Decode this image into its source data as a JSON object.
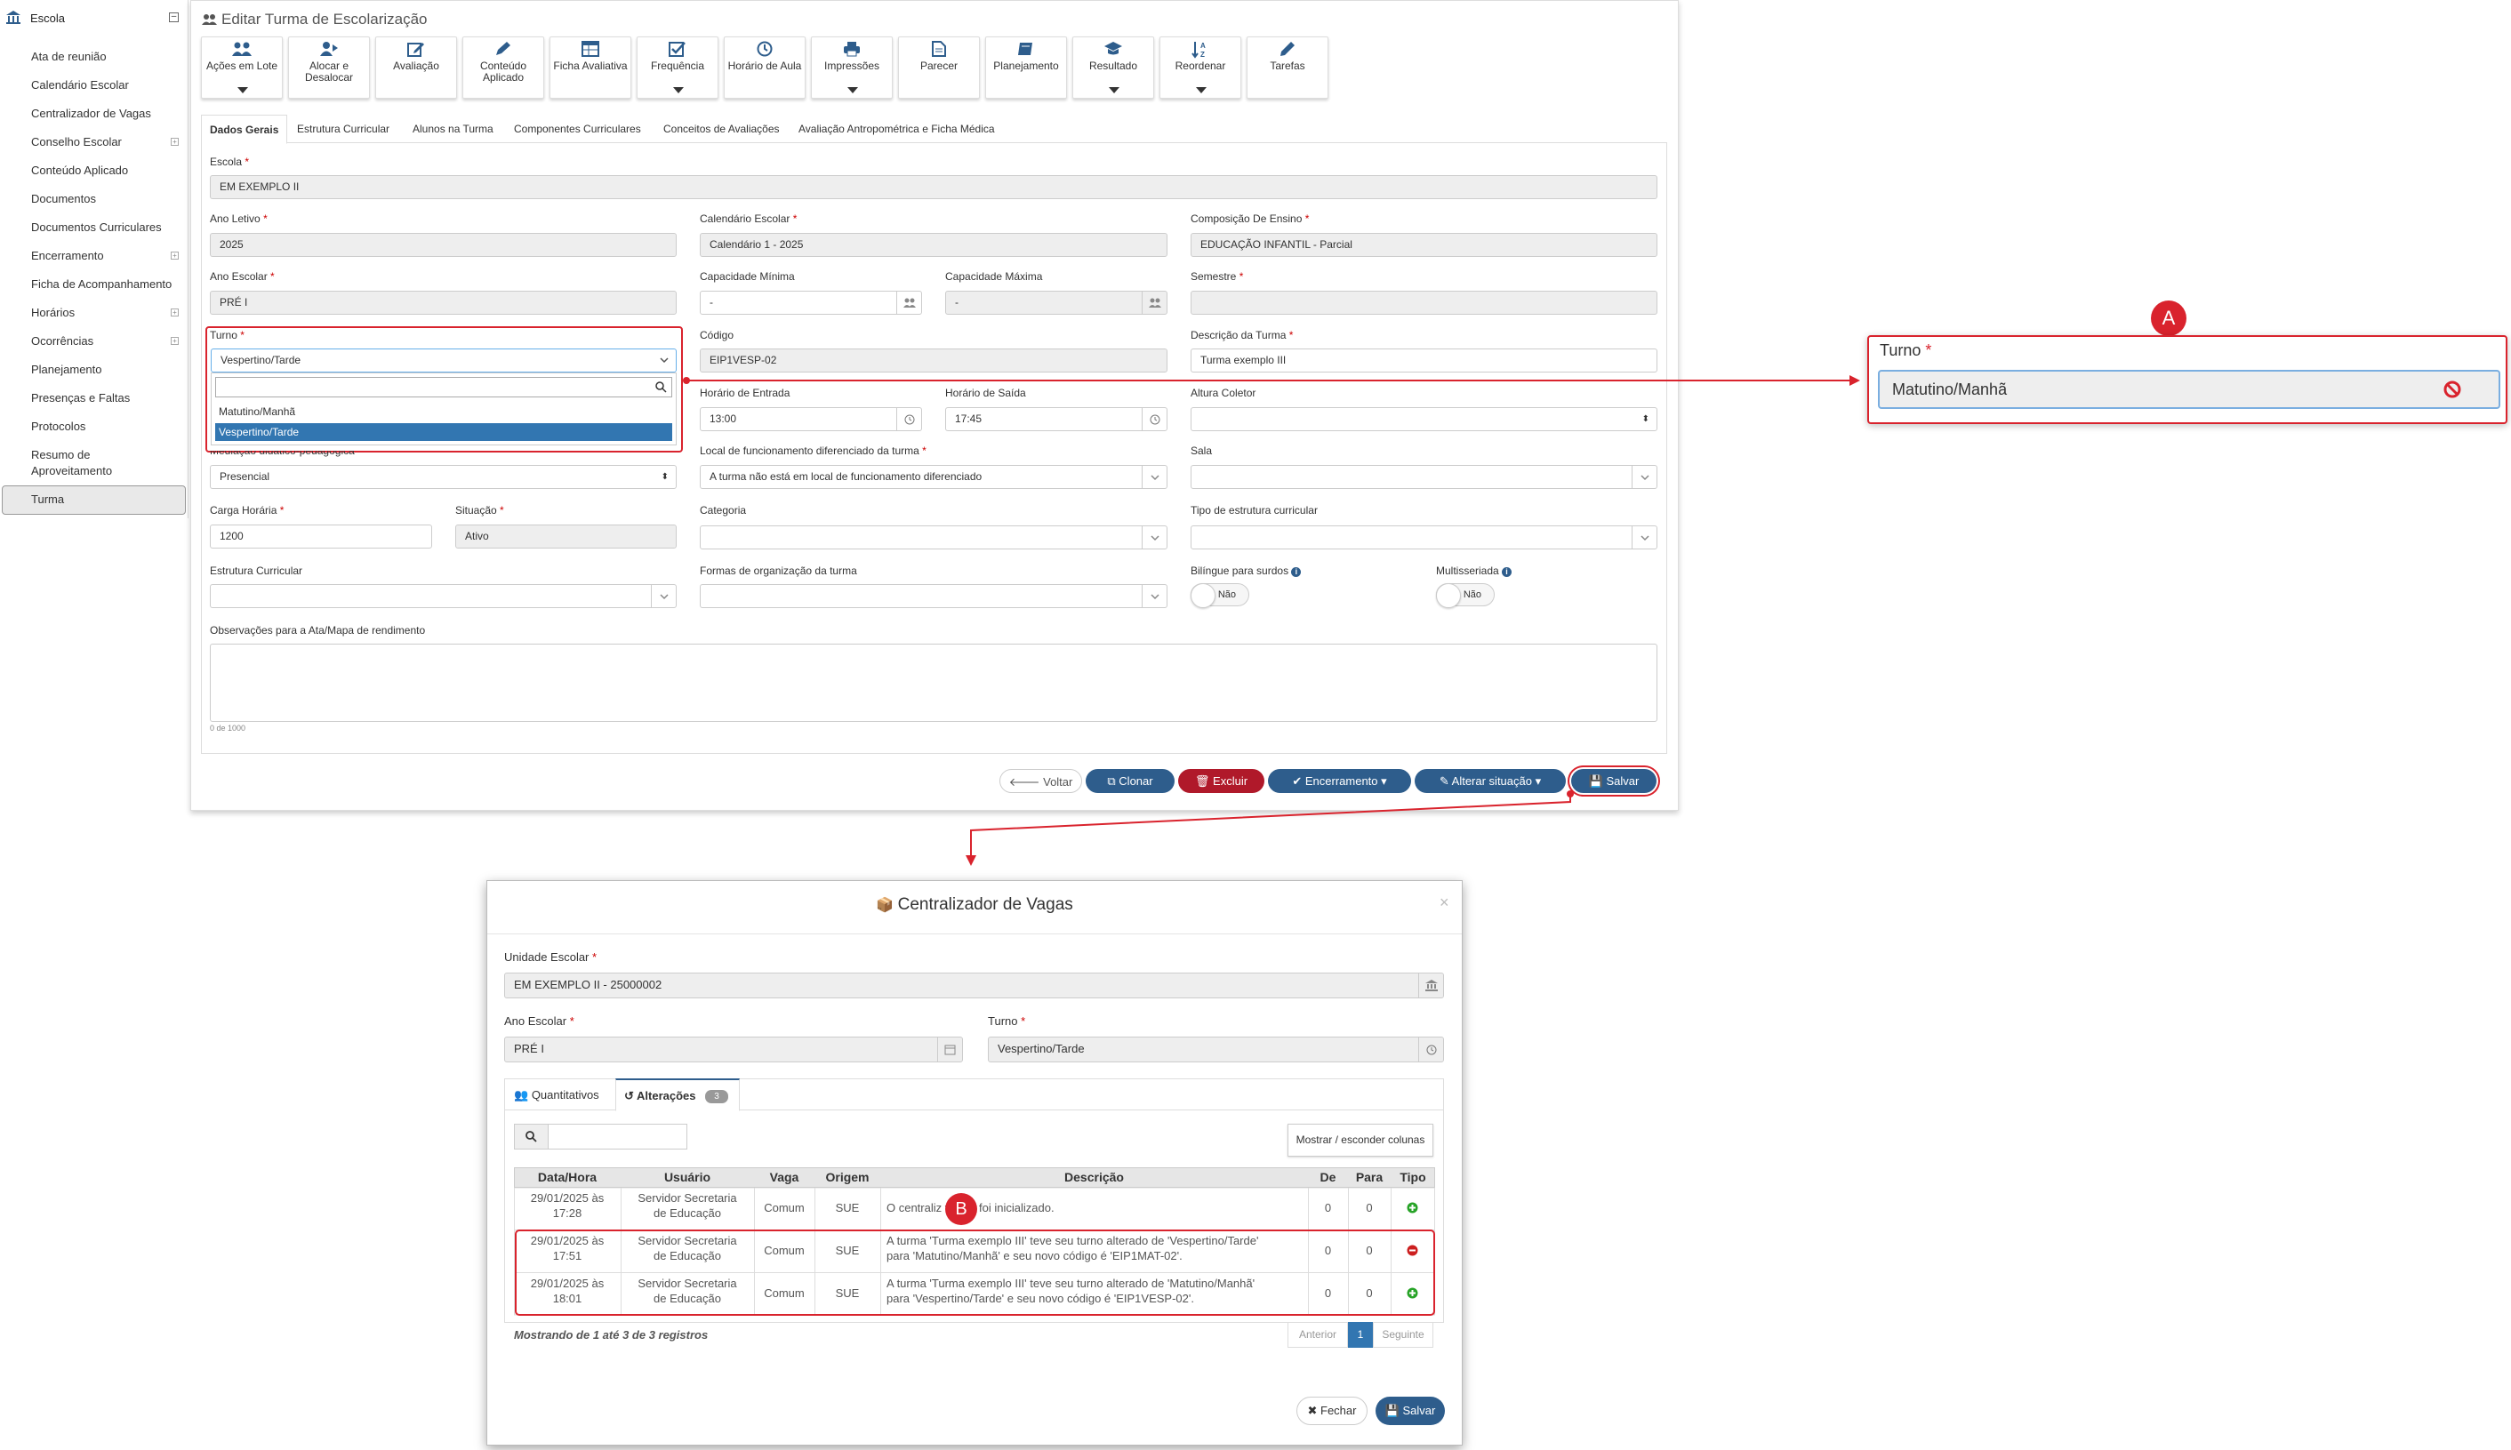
{
  "sidebar": {
    "title": "Escola",
    "items": [
      {
        "label": "Ata de reunião"
      },
      {
        "label": "Calendário Escolar"
      },
      {
        "label": "Centralizador de Vagas"
      },
      {
        "label": "Conselho Escolar"
      },
      {
        "label": "Conteúdo Aplicado"
      },
      {
        "label": "Documentos"
      },
      {
        "label": "Documentos Curriculares"
      },
      {
        "label": "Encerramento"
      },
      {
        "label": "Ficha de Acompanhamento"
      },
      {
        "label": "Horários"
      },
      {
        "label": "Ocorrências"
      },
      {
        "label": "Planejamento"
      },
      {
        "label": "Presenças e Faltas"
      },
      {
        "label": "Protocolos"
      },
      {
        "label": "Resumo de"
      },
      {
        "label": "Aproveitamento"
      },
      {
        "label": "Turma"
      }
    ]
  },
  "page": {
    "title": "Editar Turma de Escolarização"
  },
  "toolbar": [
    {
      "label": "Ações em Lote",
      "icon": "users-icon"
    },
    {
      "label": "Alocar e Desalocar",
      "icon": "user-move-icon"
    },
    {
      "label": "Avaliação",
      "icon": "edit-icon"
    },
    {
      "label": "Conteúdo Aplicado",
      "icon": "pen-icon"
    },
    {
      "label": "Ficha Avaliativa",
      "icon": "table-icon"
    },
    {
      "label": "Frequência",
      "icon": "check-square-icon"
    },
    {
      "label": "Horário de Aula",
      "icon": "clock-icon"
    },
    {
      "label": "Impressões",
      "icon": "printer-icon"
    },
    {
      "label": "Parecer",
      "icon": "document-icon"
    },
    {
      "label": "Planejamento",
      "icon": "book-icon"
    },
    {
      "label": "Resultado",
      "icon": "graduation-cap-icon"
    },
    {
      "label": "Reordenar",
      "icon": "sort-az-icon"
    },
    {
      "label": "Tarefas",
      "icon": "pencil-icon"
    }
  ],
  "tabs": [
    {
      "label": "Dados Gerais"
    },
    {
      "label": "Estrutura Curricular"
    },
    {
      "label": "Alunos na Turma"
    },
    {
      "label": "Componentes Curriculares"
    },
    {
      "label": "Conceitos de Avaliações"
    },
    {
      "label": "Avaliação Antropométrica e Ficha Médica"
    }
  ],
  "form": {
    "escola": {
      "label": "Escola",
      "value": "EM EXEMPLO II"
    },
    "ano_letivo": {
      "label": "Ano Letivo",
      "value": "2025"
    },
    "calendario": {
      "label": "Calendário Escolar",
      "value": "Calendário 1 - 2025"
    },
    "composicao": {
      "label": "Composição De Ensino",
      "value": "EDUCAÇÃO INFANTIL - Parcial"
    },
    "ano_escolar": {
      "label": "Ano Escolar",
      "value": "PRÉ I"
    },
    "cap_min": {
      "label": "Capacidade Mínima",
      "value": "-"
    },
    "cap_max": {
      "label": "Capacidade Máxima",
      "value": "-"
    },
    "semestre": {
      "label": "Semestre",
      "value": ""
    },
    "turno": {
      "label": "Turno",
      "value": "Vespertino/Tarde",
      "options": [
        "Matutino/Manhã",
        "Vespertino/Tarde"
      ]
    },
    "codigo": {
      "label": "Código",
      "value": "EIP1VESP-02"
    },
    "descricao": {
      "label": "Descrição da Turma",
      "value": "Turma exemplo III"
    },
    "hora_entrada": {
      "label": "Horário de Entrada",
      "value": "13:00"
    },
    "hora_saida": {
      "label": "Horário de Saída",
      "value": "17:45"
    },
    "altura": {
      "label": "Altura Coletor",
      "value": ""
    },
    "mediacao": {
      "label": "Mediação didático-pedagógica",
      "value": "Presencial"
    },
    "local": {
      "label": "Local de funcionamento diferenciado da turma",
      "value": "A turma não está em local de funcionamento diferenciado"
    },
    "sala": {
      "label": "Sala",
      "value": ""
    },
    "carga": {
      "label": "Carga Horária",
      "value": "1200"
    },
    "situacao": {
      "label": "Situação",
      "value": "Ativo"
    },
    "categoria": {
      "label": "Categoria",
      "value": ""
    },
    "tipo_estrutura": {
      "label": "Tipo de estrutura curricular",
      "value": ""
    },
    "estrutura": {
      "label": "Estrutura Curricular",
      "value": ""
    },
    "formas": {
      "label": "Formas de organização da turma",
      "value": ""
    },
    "bilingue": {
      "label": "Bilíngue para surdos",
      "value": "Não"
    },
    "multisseriada": {
      "label": "Multisseriada",
      "value": "Não"
    },
    "obs": {
      "label": "Observações para a Ata/Mapa de rendimento",
      "counter": "0 de 1000"
    }
  },
  "actions": {
    "voltar": "Voltar",
    "clonar": "Clonar",
    "excluir": "Excluir",
    "encerramento": "Encerramento",
    "alterar": "Alterar situação",
    "salvar": "Salvar"
  },
  "callout_a": {
    "marker": "A",
    "label": "Turno",
    "value": "Matutino/Manhã"
  },
  "modal": {
    "title": "Centralizador de Vagas",
    "unidade": {
      "label": "Unidade Escolar",
      "value": "EM EXEMPLO II - 25000002"
    },
    "ano_escolar": {
      "label": "Ano Escolar",
      "value": "PRÉ I"
    },
    "turno": {
      "label": "Turno",
      "value": "Vespertino/Tarde"
    },
    "tabs": [
      {
        "label": "Quantitativos"
      },
      {
        "label": "Alterações",
        "badge": "3"
      }
    ],
    "toggle_columns": "Mostrar / esconder colunas",
    "columns": [
      "Data/Hora",
      "Usuário",
      "Vaga",
      "Origem",
      "Descrição",
      "De",
      "Para",
      "Tipo"
    ],
    "rows": [
      {
        "date1": "29/01/2025 às",
        "date2": "17:28",
        "user1": "Servidor Secretaria",
        "user2": "de Educação",
        "vaga": "Comum",
        "origem": "SUE",
        "desc1": "O centraliz      vagas foi inicializado.",
        "desc2": "",
        "de": "0",
        "para": "0",
        "tipo": "add-icon"
      },
      {
        "date1": "29/01/2025 às",
        "date2": "17:51",
        "user1": "Servidor Secretaria",
        "user2": "de Educação",
        "vaga": "Comum",
        "origem": "SUE",
        "desc1": "A turma 'Turma exemplo III' teve seu turno alterado de 'Vespertino/Tarde'",
        "desc2": "para 'Matutino/Manhã' e seu novo código é 'EIP1MAT-02'.",
        "de": "0",
        "para": "0",
        "tipo": "remove-icon"
      },
      {
        "date1": "29/01/2025 às",
        "date2": "18:01",
        "user1": "Servidor Secretaria",
        "user2": "de Educação",
        "vaga": "Comum",
        "origem": "SUE",
        "desc1": "A turma 'Turma exemplo III' teve seu turno alterado de 'Matutino/Manhã'",
        "desc2": "para 'Vespertino/Tarde' e seu novo código é 'EIP1VESP-02'.",
        "de": "0",
        "para": "0",
        "tipo": "add-icon"
      }
    ],
    "footer_info": "Mostrando de 1 até 3 de 3 registros",
    "pagination": {
      "prev": "Anterior",
      "page": "1",
      "next": "Seguinte"
    },
    "close": "Fechar",
    "save": "Salvar",
    "marker": "B"
  },
  "colors": {
    "primary": "#2e5d8c",
    "danger": "#b0192a",
    "highlight": "#d9232d",
    "selected": "#3276b1",
    "add": "#27a327",
    "remove": "#cc1f1f"
  }
}
